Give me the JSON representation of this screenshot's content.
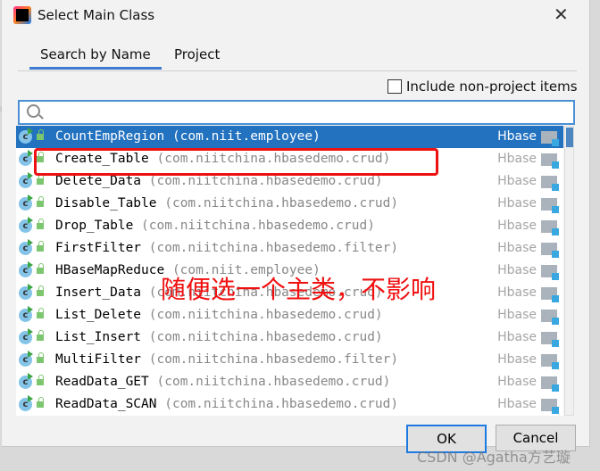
{
  "window": {
    "title": "Select Main Class",
    "close_icon": "close-icon"
  },
  "tabs": [
    {
      "label": "Search by Name",
      "active": true
    },
    {
      "label": "Project",
      "active": false
    }
  ],
  "include_non_project": {
    "label": "Include non-project items",
    "checked": false
  },
  "search": {
    "value": "",
    "placeholder": ""
  },
  "classes": [
    {
      "name": "CountEmpRegion",
      "package": "(com.niit.employee)",
      "module": "Hbase",
      "selected": true
    },
    {
      "name": "Create_Table",
      "package": "(com.niitchina.hbasedemo.crud)",
      "module": "Hbase"
    },
    {
      "name": "Delete_Data",
      "package": "(com.niitchina.hbasedemo.crud)",
      "module": "Hbase"
    },
    {
      "name": "Disable_Table",
      "package": "(com.niitchina.hbasedemo.crud)",
      "module": "Hbase"
    },
    {
      "name": "Drop_Table",
      "package": "(com.niitchina.hbasedemo.crud)",
      "module": "Hbase"
    },
    {
      "name": "FirstFilter",
      "package": "(com.niitchina.hbasedemo.filter)",
      "module": "Hbase"
    },
    {
      "name": "HBaseMapReduce",
      "package": "(com.niit.employee)",
      "module": "Hbase"
    },
    {
      "name": "Insert_Data",
      "package": "(com.niitchina.hbasedemo.crud)",
      "module": "Hbase"
    },
    {
      "name": "List_Delete",
      "package": "(com.niitchina.hbasedemo.crud)",
      "module": "Hbase"
    },
    {
      "name": "List_Insert",
      "package": "(com.niitchina.hbasedemo.crud)",
      "module": "Hbase"
    },
    {
      "name": "MultiFilter",
      "package": "(com.niitchina.hbasedemo.filter)",
      "module": "Hbase"
    },
    {
      "name": "ReadData_GET",
      "package": "(com.niitchina.hbasedemo.crud)",
      "module": "Hbase"
    },
    {
      "name": "ReadData_SCAN",
      "package": "(com.niitchina.hbasedemo.crud)",
      "module": "Hbase"
    }
  ],
  "annotation": "随便选一个主类，不影响",
  "buttons": {
    "ok": "OK",
    "cancel": "Cancel"
  },
  "watermark": "CSDN @Agatha方艺璇",
  "colors": {
    "selection": "#2272c0",
    "accent": "#3d7bd1",
    "annotation": "#f01010"
  }
}
